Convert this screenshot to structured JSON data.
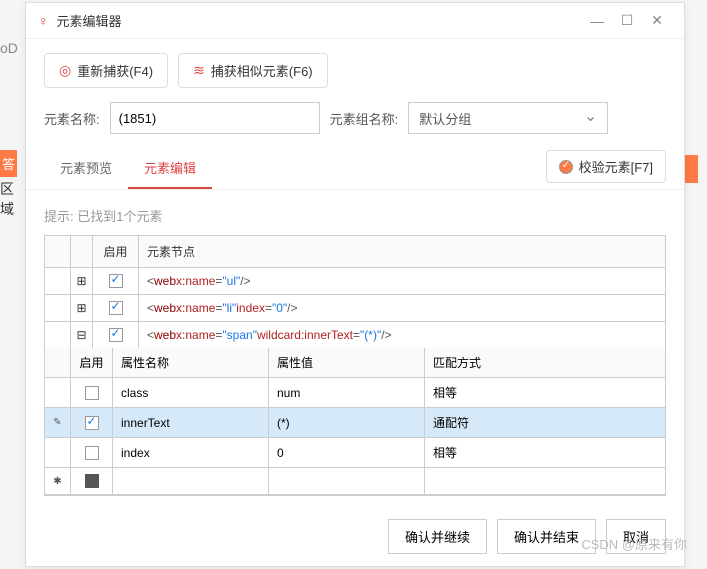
{
  "bg": {
    "left_hint": "oD",
    "left_tag1": "答",
    "left_tag2": "区域"
  },
  "titlebar": {
    "title": "元素编辑器"
  },
  "toolbar": {
    "recapture_label": "重新捕获(F4)",
    "capture_similar_label": "捕获相似元素(F6)"
  },
  "form": {
    "name_label": "元素名称:",
    "name_value": "(1851)",
    "group_label": "元素组名称:",
    "group_value": "默认分组"
  },
  "tabs": {
    "preview_label": "元素预览",
    "edit_label": "元素编辑",
    "validate_label": "校验元素[F7]"
  },
  "panel": {
    "hint": "提示: 已找到1个元素",
    "header_enable": "启用",
    "header_node": "元素节点",
    "nodes": [
      {
        "expand": "⊞",
        "checked": true,
        "xml_name": "ul"
      },
      {
        "expand": "⊞",
        "checked": true,
        "xml_name": "li",
        "xml_extra_attr": "index",
        "xml_extra_val": "\"0\""
      },
      {
        "expand": "⊟",
        "checked": true,
        "xml_name": "span",
        "xml_extra_attr": "wildcard:innerText",
        "xml_extra_val": "\"(*)\""
      }
    ],
    "sub_header": {
      "enable": "启用",
      "name": "属性名称",
      "value": "属性值",
      "match": "匹配方式"
    },
    "sub_rows": [
      {
        "checked": false,
        "name": "class",
        "value": "num",
        "match": "相等",
        "sel": false
      },
      {
        "checked": true,
        "name": "innerText",
        "value": "(*)",
        "match": "通配符",
        "sel": true
      },
      {
        "checked": false,
        "name": "index",
        "value": "0",
        "match": "相等",
        "sel": false
      }
    ]
  },
  "footer": {
    "confirm_continue": "确认并继续",
    "confirm_end": "确认并结束",
    "cancel": "取消"
  },
  "watermark": "CSDN @原来有你"
}
